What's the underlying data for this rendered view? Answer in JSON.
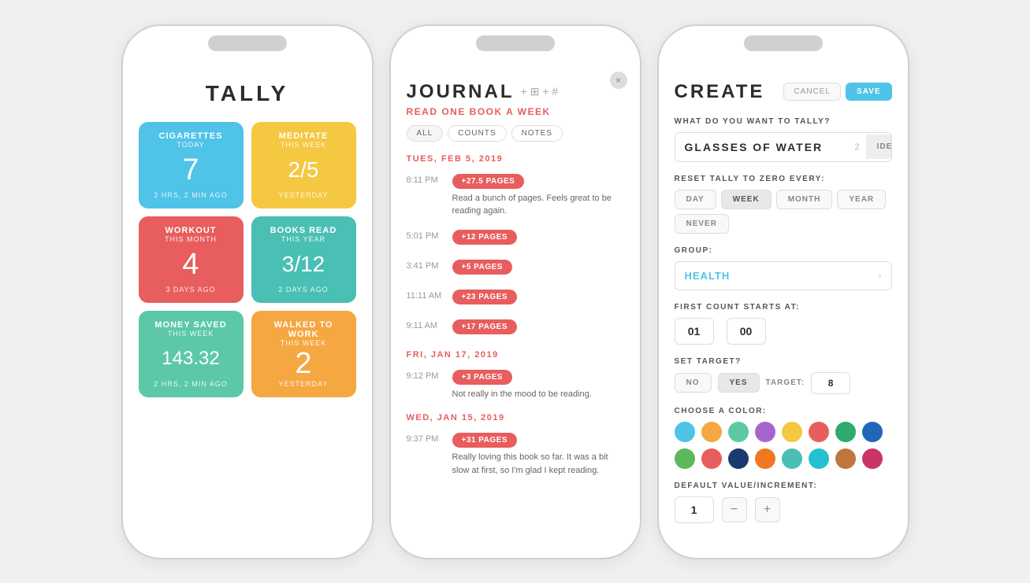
{
  "phone1": {
    "title": "TALLY",
    "cards": [
      {
        "id": "cigarettes",
        "title": "CIGARETTES",
        "subtitle": "TODAY",
        "value": "7",
        "time": "2 HRS, 2 MIN AGO",
        "bg": "bg-blue"
      },
      {
        "id": "meditate",
        "title": "MEDITATE",
        "subtitle": "THIS WEEK",
        "value": "2/5",
        "time": "YESTERDAY",
        "bg": "bg-yellow"
      },
      {
        "id": "workout",
        "title": "WORKOUT",
        "subtitle": "THIS MONTH",
        "value": "4",
        "time": "3 DAYS AGO",
        "bg": "bg-red"
      },
      {
        "id": "books-read",
        "title": "BOOKS READ",
        "subtitle": "THIS YEAR",
        "value": "3/12",
        "time": "2 DAYS AGO",
        "bg": "bg-teal"
      },
      {
        "id": "money-saved",
        "title": "MONEY SAVED",
        "subtitle": "THIS WEEK",
        "value": "143.32",
        "time": "2 HRS, 2 MIN AGO",
        "bg": "bg-green"
      },
      {
        "id": "walked",
        "title": "WALKED TO WORK",
        "subtitle": "THIS WEEK",
        "value": "2",
        "time": "YESTERDAY",
        "bg": "bg-orange"
      }
    ]
  },
  "phone2": {
    "title": "JOURNAL",
    "subtitle": "READ ONE BOOK A WEEK",
    "icons": [
      "+ ⊞",
      "+ #"
    ],
    "tabs": [
      {
        "label": "ALL",
        "active": true
      },
      {
        "label": "COUNTS",
        "active": false
      },
      {
        "label": "NOTES",
        "active": false
      }
    ],
    "close_symbol": "×",
    "sections": [
      {
        "date": "TUES, FEB 5, 2019",
        "entries": [
          {
            "time": "8:11 PM",
            "badge": "+27.5 PAGES",
            "note": "Read a bunch of pages. Feels great to be reading again."
          },
          {
            "time": "5:01 PM",
            "badge": "+12 PAGES",
            "note": ""
          },
          {
            "time": "3:41 PM",
            "badge": "+5 PAGES",
            "note": ""
          },
          {
            "time": "11:11 AM",
            "badge": "+23 PAGES",
            "note": ""
          },
          {
            "time": "9:11 AM",
            "badge": "+17 PAGES",
            "note": ""
          }
        ]
      },
      {
        "date": "FRI, JAN 17, 2019",
        "entries": [
          {
            "time": "9:12 PM",
            "badge": "+3 PAGES",
            "note": "Not really in the mood to be reading."
          }
        ]
      },
      {
        "date": "WED, JAN 15, 2019",
        "entries": [
          {
            "time": "9:37 PM",
            "badge": "+31 PAGES",
            "note": "Really loving this book so far. It was a bit slow at first, so I'm glad I kept reading."
          }
        ]
      }
    ]
  },
  "phone3": {
    "title": "CREATE",
    "cancel_label": "CANCEL",
    "save_label": "SAVE",
    "what_label": "WHAT DO YOU WANT TO TALLY?",
    "input_value": "GLASSES OF WATER",
    "input_count": "2",
    "ideas_label": "IDEAS",
    "reset_label": "RESET TALLY TO ZERO EVERY:",
    "reset_options": [
      "DAY",
      "WEEK",
      "MONTH",
      "YEAR",
      "NEVER"
    ],
    "group_label": "GROUP:",
    "group_value": "HEALTH",
    "first_count_label": "FIRST COUNT STARTS AT:",
    "first_count_hour": "01",
    "first_count_min": "00",
    "set_target_label": "SET TARGET?",
    "target_options": [
      "NO",
      "YES"
    ],
    "target_label": "TARGET:",
    "target_value": "8",
    "choose_color_label": "CHOOSE A COLOR:",
    "colors_row1": [
      "#4FC3E8",
      "#F5A742",
      "#5CC8A8",
      "#A566CC",
      "#F5C842",
      "#E85D5D",
      "#2EAA6E",
      "#2266BB"
    ],
    "colors_row2": [
      "#5CB85C",
      "#E85D5D",
      "#1A3A6E",
      "#F07820",
      "#4ABFB4",
      "#22C0D0",
      "#C0763E",
      "#CC3366"
    ],
    "default_value_label": "DEFAULT VALUE/INCREMENT:",
    "default_value": "1",
    "decrement_label": "−",
    "increment_label": "+"
  }
}
